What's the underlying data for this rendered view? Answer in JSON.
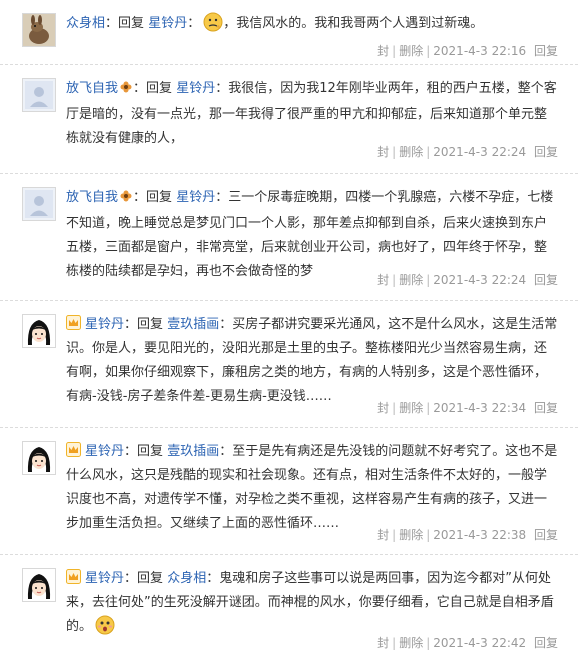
{
  "sep": "|",
  "replies": [
    {
      "author": "众身相",
      "verb": "回复",
      "target": "星铃丹",
      "colon": "：",
      "text": "，我信风水的。我和我哥两个人遇到过新魂。",
      "meta": {
        "hide": "封",
        "delete": "删除",
        "date": "2021-4-3 22:16",
        "reply": "回复"
      }
    },
    {
      "author": "放飞自我",
      "verb": "回复",
      "target": "星铃丹",
      "colon": "：",
      "text": "我很信，因为我12年刚毕业两年，租的西户五楼，整个客厅是暗的，没有一点光，那一年我得了很严重的甲亢和抑郁症，后来知道那个单元整栋就没有健康的人，",
      "meta": {
        "hide": "封",
        "delete": "删除",
        "date": "2021-4-3 22:24",
        "reply": "回复"
      }
    },
    {
      "author": "放飞自我",
      "verb": "回复",
      "target": "星铃丹",
      "colon": "：",
      "text": "三一个尿毒症晚期，四楼一个乳腺癌，六楼不孕症，七楼不知道，晚上睡觉总是梦见门口一个人影，那年差点抑郁到自杀，后来火速换到东户五楼，三面都是窗户，非常亮堂，后来就创业开公司，病也好了，四年终于怀孕，整栋楼的陆续都是孕妇，再也不会做奇怪的梦",
      "meta": {
        "hide": "封",
        "delete": "删除",
        "date": "2021-4-3 22:24",
        "reply": "回复"
      }
    },
    {
      "author": "星铃丹",
      "verb": "回复",
      "target": "壹玖插画",
      "colon": "：",
      "text": "买房子都讲究要采光通风，这不是什么风水，这是生活常识。你是人，要见阳光的，没阳光那是土里的虫子。整栋楼阳光少当然容易生病，还有啊，如果你仔细观察下，廉租房之类的地方，有病的人特别多，这是个恶性循环，有病-没钱-房子差条件差-更易生病-更没钱……",
      "meta": {
        "hide": "封",
        "delete": "删除",
        "date": "2021-4-3 22:34",
        "reply": "回复"
      }
    },
    {
      "author": "星铃丹",
      "verb": "回复",
      "target": "壹玖插画",
      "colon": "：",
      "text": "至于是先有病还是先没钱的问题就不好考究了。这也不是什么风水，这只是残酷的现实和社会现象。还有点，相对生活条件不太好的，一般学识度也不高，对遗传学不懂，对孕检之类不重视，这样容易产生有病的孩子，又进一步加重生活负担。又继续了上面的恶性循环……",
      "meta": {
        "hide": "封",
        "delete": "删除",
        "date": "2021-4-3 22:38",
        "reply": "回复"
      }
    },
    {
      "author": "星铃丹",
      "verb": "回复",
      "target": "众身相",
      "colon": "：",
      "text": "鬼魂和房子这些事可以说是两回事，因为迄今都对”从何处来，去往何处”的生死没解开谜团。而神棍的风水，你要仔细看，它自己就是自相矛盾的。",
      "meta": {
        "hide": "封",
        "delete": "删除",
        "date": "2021-4-3 22:42",
        "reply": "回复"
      }
    }
  ]
}
